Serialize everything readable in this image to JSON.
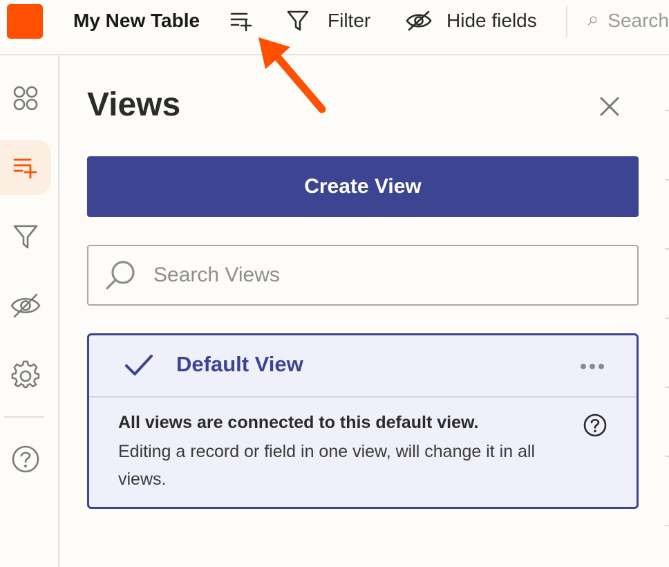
{
  "topbar": {
    "title": "My New Table",
    "filter_label": "Filter",
    "hide_fields_label": "Hide fields",
    "search_label": "Search"
  },
  "colors": {
    "brand": "#ff4f00",
    "primary": "#3d4592",
    "card_bg": "#eff0f9",
    "active_bg": "#fdeee2",
    "page_bg": "#fdfcf8"
  },
  "sidebar": {
    "items": [
      {
        "icon": "apps-icon",
        "active": false
      },
      {
        "icon": "views-add-icon",
        "active": true
      },
      {
        "icon": "filter-icon",
        "active": false
      },
      {
        "icon": "eye-off-icon",
        "active": false
      },
      {
        "icon": "gear-icon",
        "active": false
      },
      {
        "icon": "help-icon",
        "active": false
      }
    ]
  },
  "panel": {
    "title": "Views",
    "create_button": "Create View",
    "search_placeholder": "Search Views",
    "default_view": {
      "name": "Default View",
      "note_title": "All views are connected to this default view.",
      "note_body": "Editing a record or field in one view, will change it in all views."
    }
  }
}
